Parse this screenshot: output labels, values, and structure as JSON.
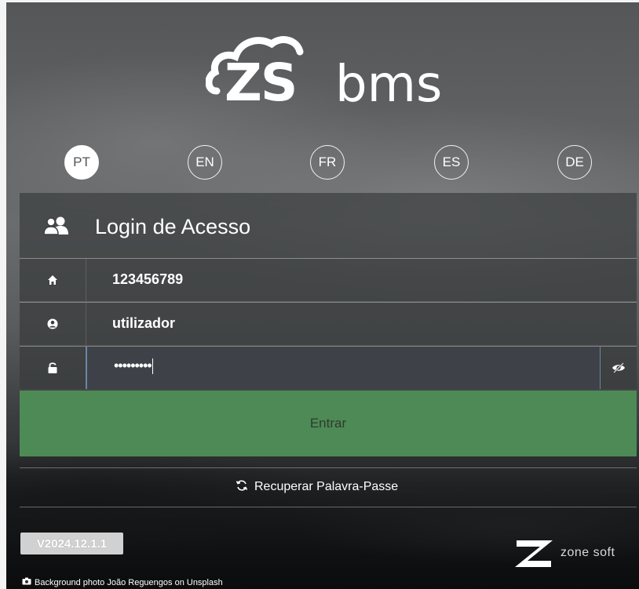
{
  "brand": {
    "logo_zs": "ZS",
    "logo_bms": "bms"
  },
  "languages": [
    {
      "code": "PT",
      "active": true
    },
    {
      "code": "EN",
      "active": false
    },
    {
      "code": "FR",
      "active": false
    },
    {
      "code": "ES",
      "active": false
    },
    {
      "code": "DE",
      "active": false
    }
  ],
  "login": {
    "title": "Login de Acesso",
    "title_icon": "users-icon",
    "company": {
      "icon": "home-icon",
      "value": "123456789"
    },
    "user": {
      "icon": "user-circle-icon",
      "value": "utilizador"
    },
    "password": {
      "icon": "lock-icon",
      "masked_value": "•••••••••",
      "toggle_icon": "eye-slash-icon"
    },
    "submit_label": "Entrar",
    "recover_icon": "refresh-icon",
    "recover_label": "Recuperar Palavra-Passe"
  },
  "footer": {
    "version": "V2024.12.1.1",
    "vendor_logo_text": "zone soft",
    "vendor_logo_icon": "zonesoft-z-icon",
    "credit_icon": "camera-icon",
    "credit": "Background photo João Reguengos on Unsplash"
  },
  "colors": {
    "submit_bg": "#4e8a55",
    "panel_bg": "#3a3c3e",
    "focus_border": "#6b86a8"
  }
}
